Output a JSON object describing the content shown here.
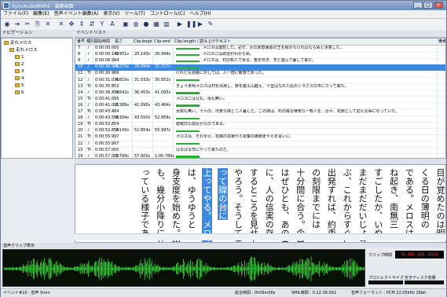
{
  "window": {
    "title": "SyncAudioMARS - 編集画面",
    "min": "_",
    "max": "□",
    "close": "×"
  },
  "menu": [
    "ファイル(F)",
    "編集(E)",
    "音声イベント編集(A)",
    "表示(V)",
    "ツール(T)",
    "コントロール(C)",
    "ヘルプ(H)"
  ],
  "toolbar_icons": [
    {
      "name": "new-doc-icon",
      "glyph": "◉"
    },
    {
      "name": "arrow-icon",
      "glyph": "➔"
    },
    {
      "name": "cut-icon",
      "glyph": "✂"
    },
    {
      "name": "copy-icon",
      "glyph": "⎘"
    },
    {
      "name": "delete-icon",
      "glyph": "✕"
    },
    {
      "name": "clear-icon",
      "glyph": "✕"
    },
    {
      "name": "move-icon",
      "glyph": "✥"
    },
    {
      "name": "split-icon",
      "glyph": "⇕"
    },
    {
      "name": "merge-icon",
      "glyph": "⇵"
    },
    {
      "name": "text-y-icon",
      "glyph": "Y"
    },
    {
      "name": "text-a-icon",
      "glyph": "A"
    },
    {
      "name": "play-segment-icon",
      "glyph": "▣"
    },
    {
      "name": "record-icon",
      "glyph": "◍"
    },
    {
      "name": "info-icon",
      "glyph": "●"
    },
    {
      "name": "grid-icon",
      "glyph": "▦"
    },
    {
      "name": "waveform-icon",
      "glyph": "▥"
    },
    {
      "name": "play-icon",
      "glyph": "▶"
    },
    {
      "name": "pause-icon",
      "glyph": "❚❚"
    },
    {
      "name": "forward-icon",
      "glyph": "▶"
    },
    {
      "name": "edit-icon",
      "glyph": "✎"
    }
  ],
  "panels": {
    "nav_title": "ナビゲーション",
    "event_title": "イベントリスト"
  },
  "tree": [
    {
      "label": "走れメロス",
      "indent": 0
    },
    {
      "label": "走れメロス",
      "indent": 1
    },
    {
      "label": "1",
      "indent": 2
    },
    {
      "label": "2",
      "indent": 2
    },
    {
      "label": "3",
      "indent": 2
    },
    {
      "label": "4",
      "indent": 2
    },
    {
      "label": "5",
      "indent": 2
    },
    {
      "label": "6",
      "indent": 2
    }
  ],
  "grid": {
    "columns": [
      "番号",
      "種別",
      "開始時間",
      "長さ",
      "Clip-begin",
      "Clip-end",
      "Clip-length / 読み上げテキスト",
      "備考"
    ],
    "rows": [
      {
        "no": "7",
        "type": "♪",
        "start": "0:00:00.000",
        "len": "",
        "cb": "",
        "ce": "",
        "text": "メロスは激怒した。必ず、かの邪智暴虐の王を除かなければならぬと決意した。",
        "sel": false
      },
      {
        "no": "8",
        "type": "♪",
        "start": "0:00:00.143",
        "len": "6.951s",
        "cb": "20.143s",
        "ce": "26.994s",
        "text": "メロスには政治がわからぬ。",
        "sel": false
      },
      {
        "no": "9",
        "type": "♪",
        "start": "0:00:06.994",
        "len": "",
        "cb": "",
        "ce": "",
        "text": "メロスは、村の牧人である。笛を吹き、羊と遊んで暮して来た。",
        "sel": false
      },
      {
        "no": "10",
        "type": "♪",
        "start": "0:00:30.966",
        "len": "4.223s",
        "cb": "26.994s",
        "ce": "31.217s",
        "text": "",
        "sel": true
      },
      {
        "no": "11",
        "type": "Tt",
        "start": "0:00:30.966",
        "len": "",
        "cb": "",
        "ce": "",
        "text": "けれども邪悪に対しては、人一倍に敏感であった。",
        "sel": false
      },
      {
        "no": "12",
        "type": "♪",
        "start": "0:00:31.033",
        "len": "4.819s",
        "cb": "31.033s",
        "ce": "35.852s",
        "text": "",
        "sel": false
      },
      {
        "no": "13",
        "type": "Tt",
        "start": "0:00:35.852",
        "len": "",
        "cb": "",
        "ce": "",
        "text": "きょう未明メロスは村を出発し、野を越え山越え、十里はなれた此のシラクスの市にやって来た。",
        "sel": false
      },
      {
        "no": "14",
        "type": "♪",
        "start": "0:00:36.453",
        "len": "4.642s",
        "cb": "36.453s",
        "ce": "41.095s",
        "text": "",
        "sel": false
      },
      {
        "no": "15",
        "type": "Tt",
        "start": "0:00:41.095",
        "len": "",
        "cb": "",
        "ce": "",
        "text": "メロスには父も、母も無い。",
        "sel": false
      },
      {
        "no": "16",
        "type": "♪",
        "start": "0:00:41.095",
        "len": "2.389s",
        "cb": "41.095s",
        "ce": "43.484s",
        "text": "",
        "sel": false
      },
      {
        "no": "17",
        "type": "Tt",
        "start": "0:00:43.484",
        "len": "",
        "cb": "",
        "ce": "",
        "text": "女房も無い。十六の、内気な妹と二人暮しだ。この妹は、村の或る律気な一牧人を、近々、花婿として迎える事になっていた。",
        "sel": false
      },
      {
        "no": "18",
        "type": "♪",
        "start": "0:00:43.550",
        "len": "9.304s",
        "cb": "43.550s",
        "ce": "52.854s",
        "text": "",
        "sel": false
      },
      {
        "no": "19",
        "type": "Tt",
        "start": "0:00:52.854",
        "len": "",
        "cb": "",
        "ce": "",
        "text": "結婚式も間近かなのである。",
        "sel": false
      },
      {
        "no": "20",
        "type": "♪",
        "start": "0:00:52.854",
        "len": "3.143s",
        "cb": "52.854s",
        "ce": "55.997s",
        "text": "",
        "sel": false
      },
      {
        "no": "21",
        "type": "Tt",
        "start": "0:00:55.997",
        "len": "",
        "cb": "",
        "ce": "",
        "text": "メロスは、それゆえ、花嫁の衣裳やら祝宴の御馳走やらを買いに、",
        "sel": false
      },
      {
        "no": "22",
        "type": "♪",
        "start": "0:00:55.997",
        "len": "",
        "cb": "",
        "ce": "",
        "text": "",
        "sel": false
      },
      {
        "no": "23",
        "type": "Tt",
        "start": "0:00:57.000",
        "len": "",
        "cb": "",
        "ce": "",
        "text": "はるばる市にやって来たのだ。",
        "sel": false
      },
      {
        "no": "24",
        "type": "♪",
        "start": "0:00:57.000",
        "len": "3.789s",
        "cb": "57.000s",
        "ce": "1:00.789s",
        "text": "",
        "sel": false
      }
    ]
  },
  "vertical_columns": [
    {
      "text": "目が覚めたのは明",
      "hl": false
    },
    {
      "text": "くる日の薄明の",
      "hl": false
    },
    {
      "text": "である。メロスは",
      "hl": false
    },
    {
      "text": "ね起き、南無三",
      "hl": false
    },
    {
      "text": "すごしたか、いや",
      "hl": false
    },
    {
      "text": "まだまだだいじょう",
      "hl": false
    },
    {
      "text": "ぶ、これからすぐに",
      "hl": false
    },
    {
      "text": "出発すれば、約束",
      "hl": false
    },
    {
      "text": "の刻限までには",
      "hl": false
    },
    {
      "text": "十分間に合う。今日",
      "hl": false
    },
    {
      "text": "はぜひとも、あの王",
      "hl": false
    },
    {
      "text": "に、人の信実の存",
      "hl": false
    },
    {
      "text": "するところを見せて",
      "hl": false
    },
    {
      "text": "やろう。そうして笑",
      "hl": false
    },
    {
      "text": "って磔の台に",
      "hl": true
    },
    {
      "text": "上ってやる。メロス",
      "hl": true
    },
    {
      "text": "は、ゆうゆうと",
      "hl": false
    },
    {
      "text": "身支度を始めた。雨",
      "hl": false
    },
    {
      "text": "も、幾分小降りにな",
      "hl": false
    },
    {
      "text": "っている様子であ",
      "hl": false
    }
  ],
  "wave": {
    "title": "音声クリップ表示"
  },
  "side": {
    "clip_time_label": "クリップ時間",
    "clip_time": "0:00:00.000",
    "project_size_label": "プロジェクトサイズ",
    "free_disk_label": "空きディスク容量"
  },
  "status": {
    "event": "イベント#10 : 音声 5min",
    "total_time_label": "総合時間 : 0h09m56s",
    "smil_label": "SMIL時間 : 0:12:36.002",
    "format_label": "音声フォーマット : PCM 22.05kHz 16bit"
  }
}
